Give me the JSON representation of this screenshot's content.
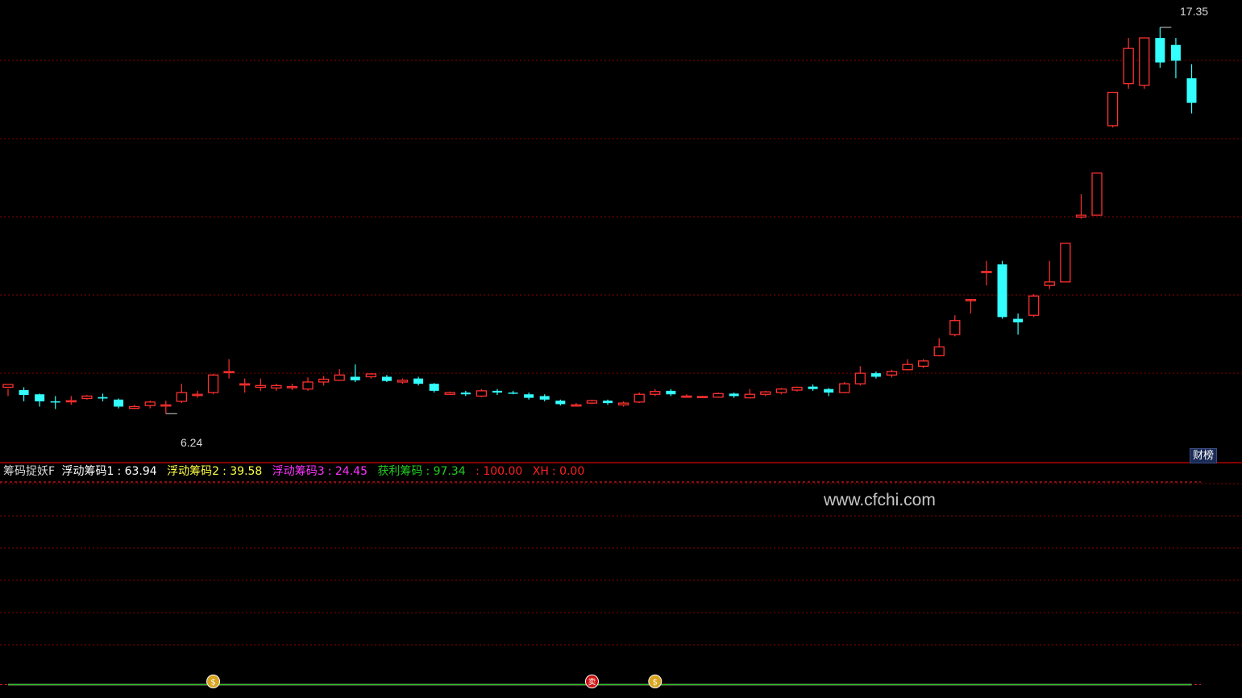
{
  "chart_data": [
    {
      "type": "candlestick",
      "title": "",
      "annotations": {
        "high_label": "17.35",
        "low_label": "6.24"
      },
      "badge": "财榜",
      "candles": [
        [
          7.1,
          7.18,
          6.85,
          7.05
        ],
        [
          7.02,
          6.88,
          6.7,
          7.1
        ],
        [
          6.9,
          6.7,
          6.55,
          6.92
        ],
        [
          6.7,
          6.68,
          6.48,
          6.85
        ],
        [
          6.7,
          6.72,
          6.6,
          6.85
        ],
        [
          6.78,
          6.85,
          6.75,
          6.88
        ],
        [
          6.82,
          6.78,
          6.7,
          6.92
        ],
        [
          6.75,
          6.55,
          6.5,
          6.78
        ],
        [
          6.5,
          6.55,
          6.48,
          6.6
        ],
        [
          6.58,
          6.68,
          6.5,
          6.72
        ],
        [
          6.6,
          6.6,
          6.35,
          6.72
        ],
        [
          6.7,
          6.95,
          6.65,
          7.2
        ],
        [
          6.9,
          6.9,
          6.8,
          7.0
        ],
        [
          6.95,
          7.45,
          6.9,
          7.48
        ],
        [
          7.55,
          7.55,
          7.35,
          7.9
        ],
        [
          7.2,
          7.2,
          6.95,
          7.35
        ],
        [
          7.1,
          7.15,
          7.0,
          7.35
        ],
        [
          7.08,
          7.15,
          7.0,
          7.2
        ],
        [
          7.1,
          7.12,
          7.02,
          7.2
        ],
        [
          7.05,
          7.25,
          7.0,
          7.38
        ],
        [
          7.25,
          7.33,
          7.15,
          7.42
        ],
        [
          7.3,
          7.45,
          7.28,
          7.62
        ],
        [
          7.4,
          7.3,
          7.25,
          7.75
        ],
        [
          7.4,
          7.48,
          7.35,
          7.5
        ],
        [
          7.4,
          7.28,
          7.25,
          7.45
        ],
        [
          7.25,
          7.3,
          7.2,
          7.35
        ],
        [
          7.35,
          7.2,
          7.15,
          7.4
        ],
        [
          7.2,
          7.0,
          6.95,
          7.22
        ],
        [
          6.9,
          6.95,
          6.88,
          6.98
        ],
        [
          6.95,
          6.9,
          6.85,
          7.0
        ],
        [
          6.85,
          7.0,
          6.82,
          7.05
        ],
        [
          7.0,
          6.95,
          6.88,
          7.05
        ],
        [
          6.95,
          6.93,
          6.9,
          7.0
        ],
        [
          6.9,
          6.8,
          6.75,
          6.95
        ],
        [
          6.85,
          6.75,
          6.7,
          6.9
        ],
        [
          6.72,
          6.62,
          6.58,
          6.75
        ],
        [
          6.6,
          6.6,
          6.55,
          6.65
        ],
        [
          6.65,
          6.72,
          6.62,
          6.75
        ],
        [
          6.72,
          6.65,
          6.6,
          6.75
        ],
        [
          6.6,
          6.65,
          6.55,
          6.7
        ],
        [
          6.68,
          6.9,
          6.65,
          6.95
        ],
        [
          6.9,
          6.98,
          6.85,
          7.05
        ],
        [
          7.0,
          6.9,
          6.85,
          7.05
        ],
        [
          6.85,
          6.85,
          6.8,
          6.9
        ],
        [
          6.82,
          6.84,
          6.8,
          6.86
        ],
        [
          6.82,
          6.92,
          6.8,
          6.95
        ],
        [
          6.92,
          6.85,
          6.8,
          6.95
        ],
        [
          6.8,
          6.9,
          6.78,
          7.05
        ],
        [
          6.9,
          6.97,
          6.85,
          7.0
        ],
        [
          6.95,
          7.05,
          6.9,
          7.08
        ],
        [
          7.02,
          7.1,
          6.98,
          7.12
        ],
        [
          7.12,
          7.05,
          7.0,
          7.18
        ],
        [
          7.05,
          6.95,
          6.85,
          7.08
        ],
        [
          6.95,
          7.2,
          6.93,
          7.25
        ],
        [
          7.2,
          7.5,
          7.15,
          7.7
        ],
        [
          7.5,
          7.4,
          7.35,
          7.55
        ],
        [
          7.45,
          7.55,
          7.38,
          7.6
        ],
        [
          7.6,
          7.75,
          7.58,
          7.9
        ],
        [
          7.7,
          7.85,
          7.65,
          7.9
        ],
        [
          8.0,
          8.25,
          7.98,
          8.5
        ],
        [
          8.6,
          9.0,
          8.55,
          9.15
        ],
        [
          9.6,
          9.6,
          9.2,
          9.6
        ],
        [
          10.4,
          10.4,
          10.0,
          10.7
        ],
        [
          10.6,
          9.1,
          9.05,
          10.7
        ],
        [
          9.05,
          8.95,
          8.6,
          9.2
        ],
        [
          9.15,
          9.7,
          9.1,
          9.75
        ],
        [
          10.0,
          10.1,
          9.9,
          10.7
        ],
        [
          10.1,
          11.2,
          10.1,
          11.2
        ],
        [
          11.95,
          12.0,
          11.9,
          12.6
        ],
        [
          12.0,
          13.2,
          12.0,
          13.2
        ],
        [
          14.55,
          15.5,
          14.5,
          15.5
        ],
        [
          15.75,
          16.75,
          15.6,
          17.05
        ],
        [
          15.7,
          17.05,
          15.6,
          17.05
        ],
        [
          17.05,
          16.35,
          16.2,
          17.35
        ],
        [
          16.85,
          16.4,
          15.9,
          17.05
        ],
        [
          15.9,
          15.2,
          14.9,
          16.3
        ]
      ],
      "low_label_index": 10,
      "high_label_index": 73
    },
    {
      "type": "line",
      "indicator": {
        "name": "筹码捉妖F",
        "series1": "浮动筹码1",
        "value1": "63.94",
        "series2": "浮动筹码2",
        "value2": "39.58",
        "series3": "浮动筹码3",
        "value3": "24.45",
        "series4": "获利筹码",
        "value4": "97.34",
        "value5": "100.00",
        "series6": "XH",
        "value6": "0.00"
      },
      "hlines": [
        100,
        0
      ],
      "series": [
        {
          "name": "浮动筹码1",
          "color": "#ffffff",
          "values": [
            0,
            0,
            0,
            0,
            0,
            0,
            0,
            0,
            0,
            0,
            0,
            0,
            0,
            0,
            0,
            0,
            0,
            0,
            0,
            0,
            0,
            0,
            0,
            0,
            0,
            0,
            0,
            0,
            0,
            0,
            0,
            0,
            0,
            0,
            0,
            0,
            0,
            0,
            0,
            0,
            0,
            0,
            0,
            0,
            0,
            0,
            0,
            0,
            0,
            0,
            0,
            0,
            0,
            0,
            0,
            0,
            0,
            0,
            0,
            0,
            0,
            0,
            0,
            0,
            0,
            0,
            0,
            0,
            0,
            0,
            0,
            0,
            0,
            0,
            0,
            0
          ]
        },
        {
          "name": "浮动筹码2",
          "color": "#ffff44",
          "values": [
            0,
            0,
            0,
            0,
            0,
            0,
            0,
            0,
            0,
            0,
            0,
            0,
            0,
            0,
            0,
            0,
            0,
            0,
            0,
            0,
            0,
            0,
            0,
            0,
            0,
            0,
            0,
            0,
            0,
            0,
            0,
            0,
            0,
            0,
            0,
            0,
            0,
            0,
            0,
            0,
            0,
            0,
            0,
            0,
            0,
            0,
            0,
            0,
            0,
            0,
            0,
            0,
            0,
            0,
            0,
            0,
            0,
            0,
            0,
            0,
            0,
            0,
            0,
            0,
            0,
            0,
            0,
            0,
            0,
            0,
            0,
            0,
            0,
            0,
            0,
            0
          ]
        },
        {
          "name": "浮动筹码3",
          "color": "#ff33ff",
          "values": [
            0,
            0,
            0,
            0,
            0,
            0,
            0,
            0,
            0,
            0,
            0,
            0,
            0,
            0,
            0,
            0,
            0,
            0,
            0,
            0,
            0,
            0,
            0,
            0,
            0,
            0,
            0,
            0,
            0,
            0,
            0,
            0,
            0,
            0,
            0,
            0,
            0,
            0,
            0,
            0,
            0,
            0,
            0,
            0,
            0,
            0,
            0,
            0,
            0,
            0,
            0,
            0,
            0,
            0,
            0,
            0,
            0,
            0,
            0,
            0,
            0,
            0,
            0,
            0,
            0,
            0,
            0,
            0,
            0,
            0,
            0,
            0,
            0,
            0,
            0,
            0
          ]
        },
        {
          "name": "获利筹码",
          "color": "#22cc22",
          "values": [
            0,
            0,
            0,
            0,
            0,
            0,
            0,
            0,
            0,
            0,
            0,
            0,
            0,
            0,
            0,
            0,
            0,
            0,
            0,
            0,
            0,
            0,
            0,
            0,
            0,
            0,
            0,
            0,
            0,
            0,
            0,
            0,
            0,
            0,
            0,
            0,
            0,
            0,
            0,
            0,
            0,
            0,
            0,
            0,
            0,
            0,
            0,
            0,
            0,
            0,
            0,
            0,
            0,
            0,
            0,
            0,
            0,
            0,
            0,
            0,
            0,
            0,
            0,
            0,
            0,
            0,
            0,
            0,
            0,
            0,
            0,
            0,
            0,
            0,
            0,
            0
          ]
        }
      ],
      "markers": [
        {
          "index": 13,
          "symbol": "$"
        },
        {
          "index": 37,
          "symbol": "卖"
        },
        {
          "index": 41,
          "symbol": "$"
        }
      ]
    }
  ],
  "watermark": "www.cfchi.com",
  "colors": {
    "up": "#ff3030",
    "down": "#33ffff",
    "grid": "#8b0000",
    "axis": "#b00000"
  }
}
